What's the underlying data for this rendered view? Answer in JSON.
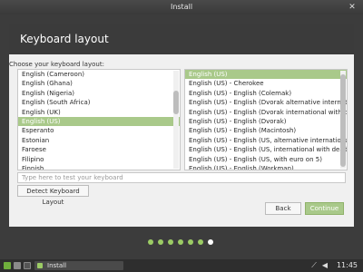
{
  "window": {
    "title": "Install"
  },
  "header": {
    "title": "Keyboard layout"
  },
  "prompt": "Choose your keyboard layout:",
  "left_list": {
    "items": [
      "English (Cameroon)",
      "English (Ghana)",
      "English (Nigeria)",
      "English (South Africa)",
      "English (UK)",
      "English (US)",
      "Esperanto",
      "Estonian",
      "Faroese",
      "Filipino",
      "Finnish"
    ],
    "selected_index": 5
  },
  "right_list": {
    "items": [
      "English (US)",
      "English (US) - Cherokee",
      "English (US) - English (Colemak)",
      "English (US) - English (Dvorak alternative international",
      "English (US) - English (Dvorak international with dead",
      "English (US) - English (Dvorak)",
      "English (US) - English (Macintosh)",
      "English (US) - English (US, alternative international)",
      "English (US) - English (US, international with dead keys",
      "English (US) - English (US, with euro on 5)",
      "English (US) - English (Workman)"
    ],
    "selected_index": 0
  },
  "test_input": {
    "placeholder": "Type here to test your keyboard",
    "value": ""
  },
  "buttons": {
    "detect": "Detect Keyboard Layout",
    "back": "Back",
    "continue": "Continue"
  },
  "progress": {
    "total_steps": 7,
    "current_step": 7
  },
  "colors": {
    "accent": "#a9c98a",
    "dot_done": "#9ccc65",
    "dot_current": "#ffffff"
  },
  "taskbar": {
    "task_title": "Install",
    "clock": "11:45"
  },
  "icons": {
    "close": "close-icon",
    "menu": "mint-menu-icon",
    "network": "network-icon",
    "volume": "volume-icon"
  }
}
